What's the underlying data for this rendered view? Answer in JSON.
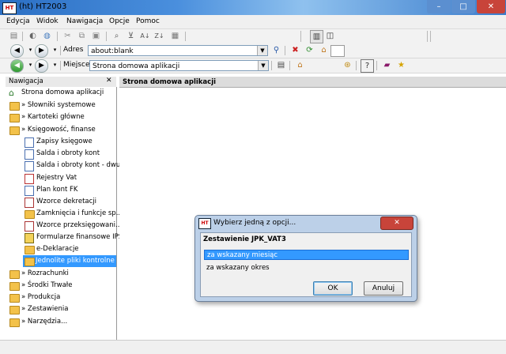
{
  "window": {
    "title": "(ht)  HT2003",
    "icon_text": "HT"
  },
  "menu": [
    "Edycja",
    "Widok",
    "Nawigacja",
    "Opcje",
    "Pomoc"
  ],
  "address": {
    "label": "Adres",
    "value": "about:blank"
  },
  "location": {
    "label": "Miejsce",
    "value": "Strona domowa aplikacji"
  },
  "navigation": {
    "title": "Nawigacja",
    "close_glyph": "✕",
    "items": [
      {
        "label": "Strona domowa aplikacji",
        "icon": "home-icon",
        "level": 0
      },
      {
        "label": "» Słowniki systemowe",
        "icon": "folder-icon",
        "level": 0
      },
      {
        "label": "» Kartoteki główne",
        "icon": "folder-icon",
        "level": 0
      },
      {
        "label": "» Księgowość, finanse",
        "icon": "folder-icon",
        "level": 0
      },
      {
        "label": "Zapisy księgowe",
        "icon": "ledger-icon",
        "level": 1
      },
      {
        "label": "Salda i obroty kont",
        "icon": "ledger-icon",
        "level": 1
      },
      {
        "label": "Salda i obroty kont - dwu...",
        "icon": "ledger-icon",
        "level": 1
      },
      {
        "label": "Rejestry Vat",
        "icon": "register-icon",
        "level": 1
      },
      {
        "label": "Plan kont FK",
        "icon": "document-icon",
        "level": 1
      },
      {
        "label": "Wzorce dekretacji",
        "icon": "template-icon",
        "level": 1
      },
      {
        "label": "Zamknięcia i funkcje sp...",
        "icon": "folder-icon",
        "level": 1
      },
      {
        "label": "Wzorce przeksięgowani...",
        "icon": "template-icon",
        "level": 1
      },
      {
        "label": "Formularze finansowe IPS",
        "icon": "form-icon",
        "level": 1
      },
      {
        "label": "e-Deklaracje",
        "icon": "folder-icon",
        "level": 1
      },
      {
        "label": "Jednolite pliki kontrolne",
        "icon": "folder-icon",
        "level": 1,
        "selected": true
      },
      {
        "label": "» Rozrachunki",
        "icon": "folder-icon",
        "level": 0
      },
      {
        "label": "» Środki Trwałe",
        "icon": "folder-icon",
        "level": 0
      },
      {
        "label": "» Produkcja",
        "icon": "folder-icon",
        "level": 0
      },
      {
        "label": "» Zestawienia",
        "icon": "folder-icon",
        "level": 0
      },
      {
        "label": "» Narzędzia...",
        "icon": "folder-icon",
        "level": 0
      }
    ]
  },
  "main": {
    "header": "Strona domowa aplikacji"
  },
  "dialog": {
    "title": "Wybierz jedną z opcji...",
    "close_glyph": "✕",
    "heading": "Zestawienie JPK_VAT3",
    "options": [
      "za wskazany miesiąc",
      "za wskazany okres"
    ],
    "selected_index": 0,
    "ok_label": "OK",
    "cancel_label": "Anuluj"
  },
  "colors": {
    "selection": "#3399ff",
    "dialog_frame": "#bcd0e8"
  }
}
